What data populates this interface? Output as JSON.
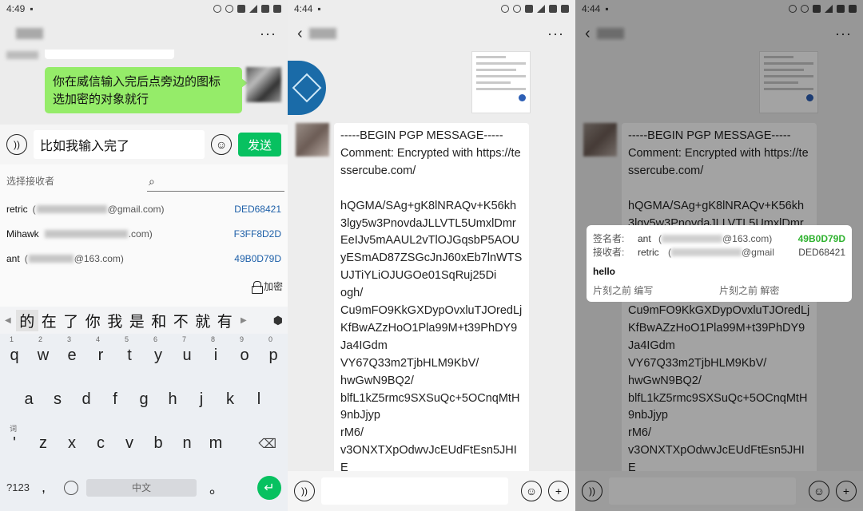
{
  "panel1": {
    "status": {
      "time": "4:49"
    },
    "menu_more": "···",
    "bubble_text": "你在威信输入完后点旁边的图标 选加密的对象就行",
    "input_text": "比如我输入完了",
    "send_label": "发送",
    "receivers": {
      "label": "选择接收者",
      "contacts": [
        {
          "name": "retric",
          "email_prefix": "(",
          "email_suffix": "@gmail.com)",
          "key": "DED68421"
        },
        {
          "name": "Mihawk",
          "email_prefix": "",
          "email_suffix": ".com)",
          "key": "F3FF8D2D"
        },
        {
          "name": "ant",
          "email_prefix": "(",
          "email_suffix": "@163.com)",
          "key": "49B0D79D"
        }
      ],
      "encrypt_label": "加密"
    },
    "candidates": [
      "的",
      "在",
      "了",
      "你",
      "我",
      "是",
      "和",
      "不",
      "就",
      "有"
    ],
    "keyboard": {
      "row1": [
        {
          "k": "q",
          "n": "1"
        },
        {
          "k": "w",
          "n": "2"
        },
        {
          "k": "e",
          "n": "3"
        },
        {
          "k": "r",
          "n": "4"
        },
        {
          "k": "t",
          "n": "5"
        },
        {
          "k": "y",
          "n": "6"
        },
        {
          "k": "u",
          "n": "7"
        },
        {
          "k": "i",
          "n": "8"
        },
        {
          "k": "o",
          "n": "9"
        },
        {
          "k": "p",
          "n": "0"
        }
      ],
      "row2": [
        "a",
        "s",
        "d",
        "f",
        "g",
        "h",
        "j",
        "k",
        "l"
      ],
      "row3": [
        "'",
        "z",
        "x",
        "c",
        "v",
        "b",
        "n",
        "m"
      ],
      "row3_hint": "词",
      "sym": "?123",
      "comma": ",",
      "space": "中文",
      "period": "。"
    }
  },
  "panel2": {
    "status": {
      "time": "4:44"
    },
    "menu_more": "···",
    "message_lines": [
      "-----BEGIN PGP MESSAGE-----",
      "Comment: Encrypted with https://tessercube.com/",
      "",
      "hQGMA/SAg+gK8lNRAQv+K56kh3lgy5w3PnovdaJLLVTL5UmxlDmrEeIJv5mAAUL2vTlOJGqsbP5AOUyESmAD87ZSGcJnJ60xEb7lnWTSUJTiYLiOJUGOe01SqRuj25Di",
      "ogh/",
      "Cu9mFO9KkGXDypOvxluTJOredLjKfBwAZzHoO1Pla99M+t39PhDY9Ja4IGdm",
      "VY67Q33m2TjbHLM9KbV/",
      "hwGwN9BQ2/",
      "blfL1kZ5rmc9SXSuQc+5OCnqMtH9nbJjyp",
      "rM6/",
      "v3ONXTXpOdwvJcEUdFtEsn5JHIE"
    ]
  },
  "panel3": {
    "status": {
      "time": "4:44"
    },
    "menu_more": "···",
    "popup": {
      "signer_label": "签名者:",
      "signer_name": "ant",
      "signer_email_prefix": "(",
      "signer_email_suffix": "@163.com)",
      "signer_key": "49B0D79D",
      "recipient_label": "接收者:",
      "recipient_name": "retric",
      "recipient_email_prefix": "(",
      "recipient_email_suffix": "@gmail",
      "recipient_key": "DED68421",
      "message": "hello",
      "left_action": "片刻之前 编写",
      "right_action": "片刻之前 解密"
    }
  },
  "colors": {
    "wechat_green": "#07c160",
    "bubble_green": "#95ec69",
    "key_blue": "#1d5fa8",
    "key_green": "#2fb22f"
  }
}
